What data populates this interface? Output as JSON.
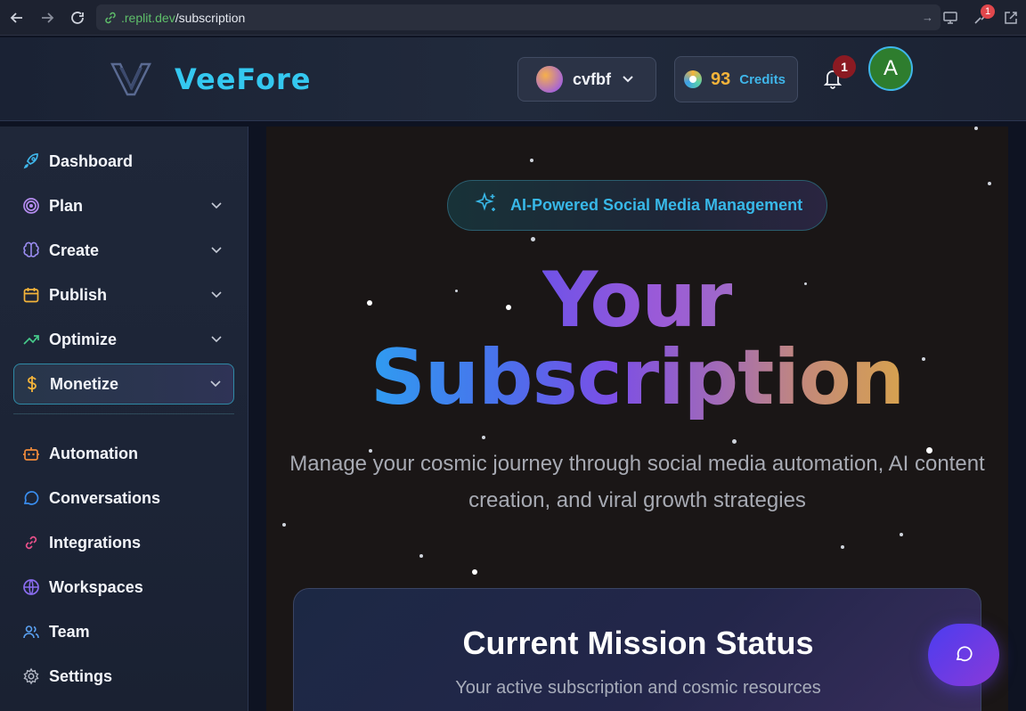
{
  "browser": {
    "url_host": ".replit.dev",
    "url_path": "/subscription",
    "extension_badge": "1"
  },
  "header": {
    "logo_text": "VeeFore",
    "workspace_name": "cvfbf",
    "credits_count": "93",
    "credits_label": "Credits",
    "notification_count": "1",
    "user_initial": "A"
  },
  "sidebar": {
    "items": [
      {
        "label": "Dashboard",
        "icon": "rocket-icon",
        "has_chevron": false
      },
      {
        "label": "Plan",
        "icon": "target-icon",
        "has_chevron": true
      },
      {
        "label": "Create",
        "icon": "brain-icon",
        "has_chevron": true
      },
      {
        "label": "Publish",
        "icon": "calendar-icon",
        "has_chevron": true
      },
      {
        "label": "Optimize",
        "icon": "trending-up-icon",
        "has_chevron": true
      },
      {
        "label": "Monetize",
        "icon": "dollar-icon",
        "has_chevron": true,
        "active": true
      },
      {
        "label": "Automation",
        "icon": "bot-icon",
        "has_chevron": false
      },
      {
        "label": "Conversations",
        "icon": "chat-bubble-icon",
        "has_chevron": false
      },
      {
        "label": "Integrations",
        "icon": "link-icon",
        "has_chevron": false
      },
      {
        "label": "Workspaces",
        "icon": "globe-icon",
        "has_chevron": false
      },
      {
        "label": "Team",
        "icon": "users-icon",
        "has_chevron": false
      },
      {
        "label": "Settings",
        "icon": "gear-icon",
        "has_chevron": false
      }
    ]
  },
  "main": {
    "badge_text": "AI-Powered Social Media Management",
    "hero_line1": "Your",
    "hero_line2": "Subscription",
    "subtitle": "Manage your cosmic journey through social media automation, AI content creation, and viral growth strategies",
    "card_title": "Current Mission Status",
    "card_subtitle": "Your active subscription and cosmic resources"
  },
  "colors": {
    "accent_cyan": "#38b8e8",
    "credits_gold": "#f4b43a",
    "notification_red": "#8b1a22",
    "avatar_green": "#2e7d2e",
    "fab_purple": "#6a3ae4"
  }
}
